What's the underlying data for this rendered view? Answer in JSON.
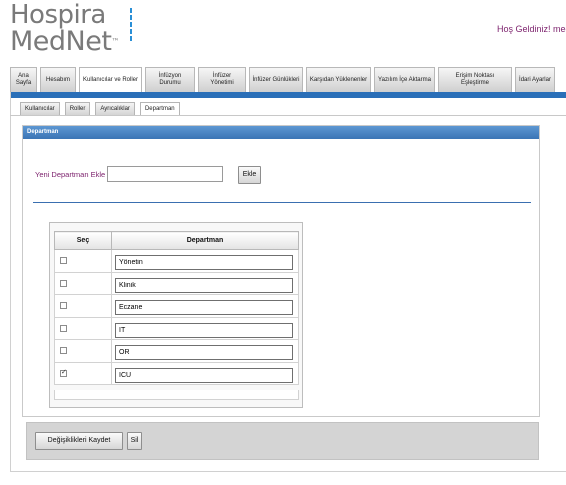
{
  "header": {
    "logo_line1": "Hospira",
    "logo_line2": "MedNet",
    "logo_tm": "™",
    "welcome_text": "Hoş Geldiniz!   medn"
  },
  "main_tabs": [
    {
      "label": "Ana Sayfa",
      "active": false
    },
    {
      "label": "Hesabım",
      "active": false
    },
    {
      "label": "Kullanıcılar ve Roller",
      "active": true
    },
    {
      "label": "İnfüzyon Durumu",
      "active": false
    },
    {
      "label": "İnfüzer Yönetimi",
      "active": false
    },
    {
      "label": "İnfüzer Günlükleri",
      "active": false
    },
    {
      "label": "Karşıdan Yüklenenler",
      "active": false
    },
    {
      "label": "Yazılım İçe Aktarma",
      "active": false
    },
    {
      "label": "Erişim Noktası Eşleştirme",
      "active": false
    },
    {
      "label": "İdari Ayarlar",
      "active": false
    }
  ],
  "sub_tabs": [
    {
      "label": "Kullanıcılar",
      "active": false
    },
    {
      "label": "Roller",
      "active": false
    },
    {
      "label": "Ayrıcalıklar",
      "active": false
    },
    {
      "label": "Departman",
      "active": true
    }
  ],
  "panel": {
    "title": "Departman",
    "add_label": "Yeni Departman Ekle",
    "add_input_value": "",
    "add_button": "Ekle"
  },
  "table": {
    "headers": {
      "select": "Seç",
      "department": "Departman"
    },
    "rows": [
      {
        "checked": false,
        "value": "Yönetin"
      },
      {
        "checked": false,
        "value": "Klinik"
      },
      {
        "checked": false,
        "value": "Eczane"
      },
      {
        "checked": false,
        "value": "IT"
      },
      {
        "checked": false,
        "value": "OR"
      },
      {
        "checked": true,
        "value": "ICU"
      }
    ]
  },
  "footer": {
    "save_button": "Değişiklikleri Kaydet",
    "delete_button": "Sil"
  }
}
